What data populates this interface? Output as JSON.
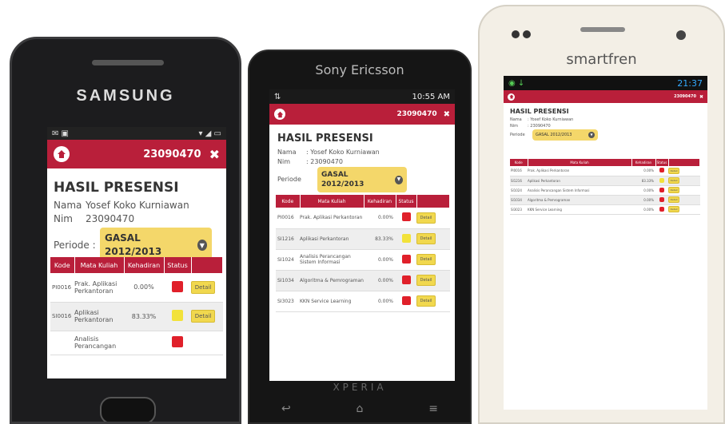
{
  "samsung": {
    "brand": "SAMSUNG",
    "nim_header": "23090470",
    "title": "HASIL PRESENSI",
    "nama_label": "Nama",
    "nama_value": "Yosef Koko Kurniawan",
    "nim_label": "Nim",
    "nim_value": "23090470",
    "periode_label": "Periode :",
    "periode_value": "GASAL 2012/2013",
    "headers": [
      "Kode",
      "Mata Kuliah",
      "Kehadiran",
      "Status"
    ],
    "rows": [
      {
        "kode": "PI0016",
        "mk": "Prak. Aplikasi Perkantoran",
        "hadir": "0.00%",
        "status": "red",
        "aksi": "Detail"
      },
      {
        "kode": "SI0016",
        "mk": "Aplikasi Perkantoran",
        "hadir": "83.33%",
        "status": "yellow",
        "aksi": "Detail"
      },
      {
        "kode": "",
        "mk": "Analisis Perancangan",
        "hadir": "",
        "status": "red",
        "aksi": ""
      }
    ]
  },
  "sony": {
    "brand": "Sony Ericsson",
    "time": "10:55 AM",
    "nim_header": "23090470",
    "title": "HASIL PRESENSI",
    "nama_label": "Nama",
    "nama_value": ": Yosef Koko Kurniawan",
    "nim_label": "Nim",
    "nim_value": ": 23090470",
    "periode_label": "Periode",
    "periode_value": "GASAL 2012/2013",
    "headers": [
      "Kode",
      "Mata Kuliah",
      "Kehadiran",
      "Status"
    ],
    "rows": [
      {
        "kode": "PI0016",
        "mk": "Prak. Aplikasi Perkantoran",
        "hadir": "0.00%",
        "status": "red",
        "aksi": "Detail"
      },
      {
        "kode": "SI1216",
        "mk": "Aplikasi Perkantoran",
        "hadir": "83.33%",
        "status": "yellow",
        "aksi": "Detail"
      },
      {
        "kode": "SI1024",
        "mk": "Analisis Perancangan Sistem Informasi",
        "hadir": "0.00%",
        "status": "red",
        "aksi": "Detail"
      },
      {
        "kode": "SI1034",
        "mk": "Algoritma & Pemrograman",
        "hadir": "0.00%",
        "status": "red",
        "aksi": "Detail"
      },
      {
        "kode": "SI3023",
        "mk": "KKN Service Learning",
        "hadir": "0.00%",
        "status": "red",
        "aksi": "Detail"
      }
    ],
    "footer_brand": "XPERIA"
  },
  "smartfren": {
    "brand": "smartfren",
    "time": "21:37",
    "nim_header": "23090470",
    "title": "HASIL PRESENSI",
    "nama_label": "Nama",
    "nama_value": ": Yosef Koko Kurniawan",
    "nim_label": "Nim",
    "nim_value": ": 23090470",
    "periode_label": "Periode",
    "periode_value": "GASAL 2012/2013",
    "headers": [
      "Kode",
      "Mata Kuliah",
      "Kehadiran",
      "Status"
    ],
    "rows": [
      {
        "kode": "PI0016",
        "mk": "Prak. Aplikasi Perkantoran",
        "hadir": "0.00%",
        "status": "red",
        "aksi": "Detail"
      },
      {
        "kode": "SI1216",
        "mk": "Aplikasi Perkantoran",
        "hadir": "83.33%",
        "status": "yellow",
        "aksi": "Detail"
      },
      {
        "kode": "SI1024",
        "mk": "Analisis Perancangan Sistem Informasi",
        "hadir": "0.00%",
        "status": "red",
        "aksi": "Detail"
      },
      {
        "kode": "SI1034",
        "mk": "Algoritma & Pemrograman",
        "hadir": "0.00%",
        "status": "red",
        "aksi": "Detail"
      },
      {
        "kode": "SI3023",
        "mk": "KKN Service Learning",
        "hadir": "0.00%",
        "status": "red",
        "aksi": "Detail"
      }
    ]
  },
  "colors": {
    "accent": "#b91f3a",
    "status_red": "#e0202a",
    "status_yellow": "#f2e23a",
    "button_yellow": "#f1d84e"
  }
}
